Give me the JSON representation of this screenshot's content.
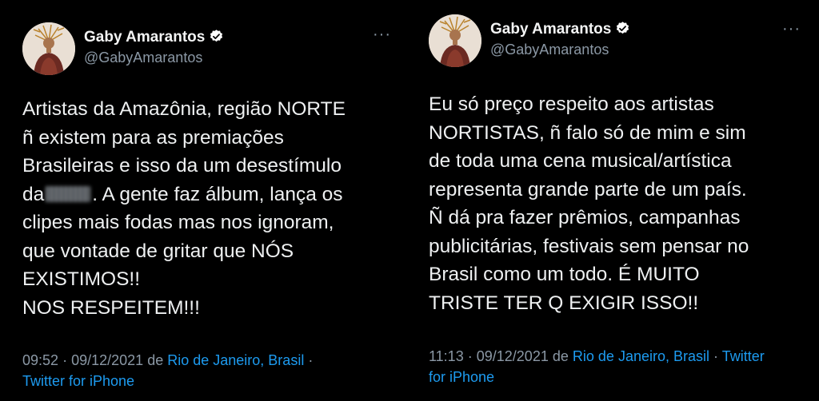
{
  "tweets": [
    {
      "author": {
        "name": "Gaby Amarantos",
        "handle": "@GabyAmarantos"
      },
      "more_label": "···",
      "text": {
        "line1": "Artistas da Amazônia, região NORTE",
        "line2": "ñ existem para as premiações",
        "line3": "Brasileiras e isso da um desestímulo",
        "line4_pre": "da",
        "line4_post": ". A gente faz álbum, lança os",
        "line5": "clipes mais fodas mas nos ignoram,",
        "line6": "que vontade de gritar que NÓS",
        "line7": "EXISTIMOS!!",
        "line8": "NOS RESPEITEM!!!"
      },
      "meta": {
        "time": "09:52",
        "date": "09/12/2021",
        "de": "de",
        "location": "Rio de Janeiro, Brasil",
        "source": "Twitter for iPhone",
        "separator": "·"
      }
    },
    {
      "author": {
        "name": "Gaby Amarantos",
        "handle": "@GabyAmarantos"
      },
      "more_label": "···",
      "text": {
        "line1": "Eu só preço respeito aos artistas",
        "line2": "NORTISTAS, ñ falo só de mim e sim",
        "line3": "de toda uma cena musical/artística",
        "line4": "representa grande parte de um país.",
        "line5": "Ñ dá pra fazer prêmios, campanhas",
        "line6": "publicitárias, festivais sem pensar no",
        "line7": "Brasil como um todo. É MUITO",
        "line8": "TRISTE TER Q EXIGIR ISSO!!"
      },
      "meta": {
        "time": "11:13",
        "date": "09/12/2021",
        "de": "de",
        "location": "Rio de Janeiro, Brasil",
        "source_part1": "Twitter",
        "source_part2": "for iPhone",
        "separator": "·"
      }
    }
  ],
  "colors": {
    "background": "#000000",
    "text": "#e7e9ea",
    "secondary": "#8b98a5",
    "link": "#1d9bf0",
    "verified": "#ffffff"
  },
  "icons": {
    "verified": "verified-badge-icon",
    "more": "more-icon",
    "avatar": "avatar"
  }
}
